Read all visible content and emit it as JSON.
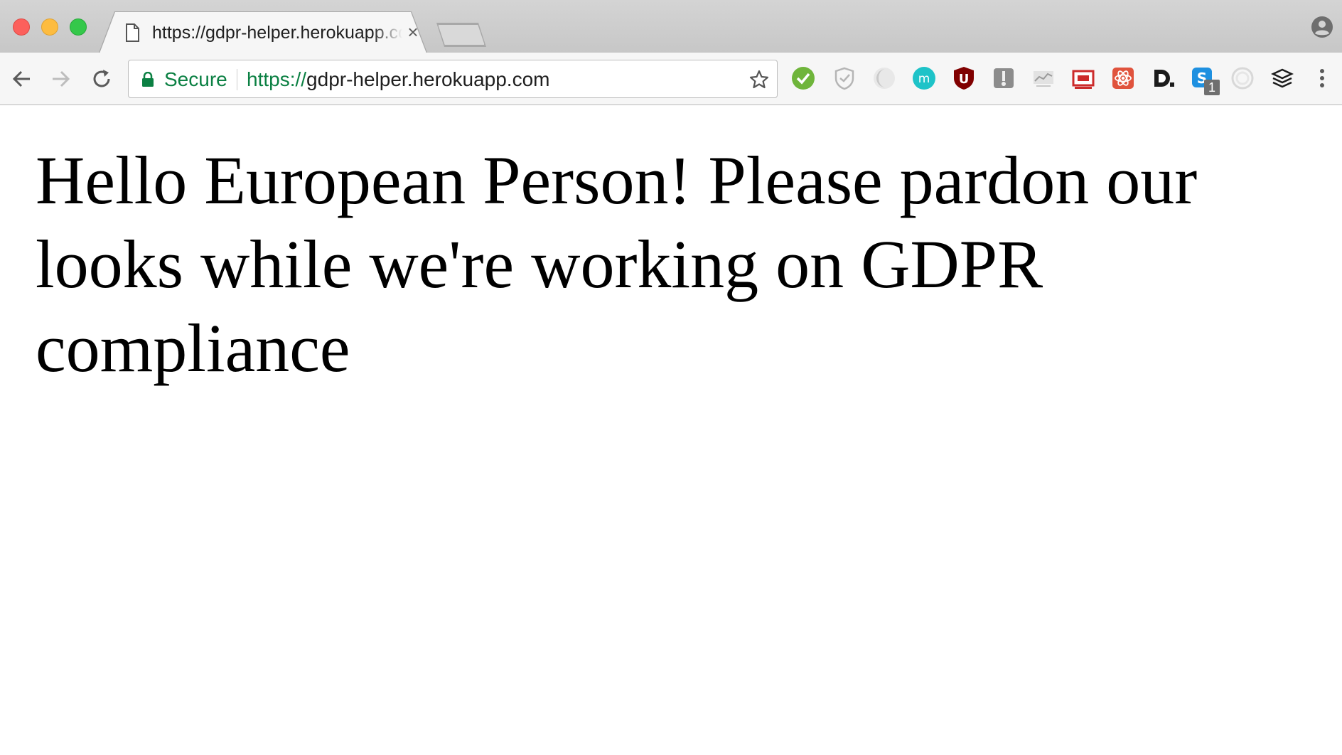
{
  "browser": {
    "window_controls": [
      "close",
      "minimize",
      "maximize"
    ],
    "tab": {
      "title": "https://gdpr-helper.herokuapp.com",
      "favicon": "page-icon",
      "close_glyph": "×"
    },
    "toolbar": {
      "back_icon": "arrow-left-icon",
      "forward_icon": "arrow-right-icon",
      "reload_icon": "reload-icon",
      "omnibox": {
        "secure_label": "Secure",
        "url_scheme": "https://",
        "url_rest": "gdpr-helper.herokuapp.com",
        "secure_color": "#0b8043"
      },
      "extensions": [
        "green-check-icon",
        "shield-icon",
        "crescent-icon",
        "teal-m-icon",
        "ublock-icon",
        "gray-tool-icon",
        "analytics-icon",
        "selenium-icon",
        "react-icon",
        "d-dot-icon",
        "skype-icon",
        "target-icon",
        "stack-icon"
      ],
      "extension_badge": "1"
    }
  },
  "page": {
    "heading": "Hello European Person! Please pardon our looks while we're working on GDPR compliance"
  }
}
